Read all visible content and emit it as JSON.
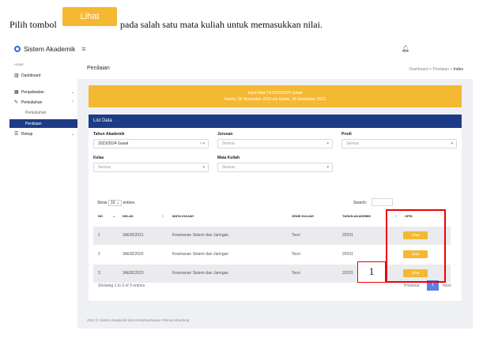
{
  "instruction": {
    "before": "Pilih tombol",
    "button_label": "Lihat",
    "after": "pada salah satu mata kuliah untuk memasukkan nilai."
  },
  "app": {
    "brand": "Sistem Akademik",
    "sidebar": {
      "heading": "HOME",
      "items": [
        {
          "label": "Dashboard",
          "icon": "bar-chart-icon"
        },
        {
          "label": "Penjadwalan",
          "icon": "calendar-icon"
        },
        {
          "label": "Perkuliahan",
          "icon": "pencil-icon"
        },
        {
          "label": "Perkuliahan",
          "icon": ""
        },
        {
          "label": "Penilaian",
          "icon": "",
          "active": true
        },
        {
          "label": "Rekap",
          "icon": "list-icon"
        }
      ]
    },
    "page_title": "Penilaian",
    "breadcrumb": [
      "Dashboard",
      "Penilaian",
      "Index"
    ],
    "notice": {
      "line1": "Input Nilai TA 2023/2024 Gasal",
      "line2": "Kamis, 09 November 2023 s/d Kamis, 30 November 2023"
    },
    "card_title": "List Data",
    "filters": {
      "tahun_akademik": {
        "label": "Tahun Akademik",
        "value": "2023/2024 Gasal"
      },
      "jurusan": {
        "label": "Jurusan",
        "placeholder": "Semua"
      },
      "prodi": {
        "label": "Prodi",
        "placeholder": "Semua"
      },
      "kelas": {
        "label": "Kelas",
        "placeholder": "Semua"
      },
      "mata_kuliah": {
        "label": "Mata Kuliah",
        "placeholder": "Semua"
      }
    },
    "show": {
      "prefix": "Show",
      "value": "10",
      "suffix": "entries"
    },
    "search_label": "Search:",
    "columns": [
      "NO",
      "KELAS",
      "MATA KULIAH",
      "JENIS KULIAH",
      "TAHUN AKADEMIK",
      "OPSI"
    ],
    "rows": [
      {
        "no": "1",
        "kelas": "3AEB22021",
        "mata_kuliah": "Keamanan Sistem dan Jaringan",
        "jenis": "Teori",
        "tahun": "20231",
        "opsi": "Lihat"
      },
      {
        "no": "2",
        "kelas": "3AEB22022",
        "mata_kuliah": "Keamanan Sistem dan Jaringan",
        "jenis": "Teori",
        "tahun": "20231",
        "opsi": "Lihat"
      },
      {
        "no": "3",
        "kelas": "3AEB22023",
        "mata_kuliah": "Keamanan Sistem dan Jaringan",
        "jenis": "Teori",
        "tahun": "20231",
        "opsi": "Lihat"
      }
    ],
    "entries_info": "Showing 1 to 3 of 3 entries",
    "pagination": {
      "previous": "Previous",
      "current": "1",
      "next": "Next"
    },
    "footer": "2022 © Sistem Akademik dan Kemahasiswaan Polman Bandung"
  },
  "annotation": {
    "step_number": "1"
  },
  "colors": {
    "accent_yellow": "#f5b833",
    "primary_blue": "#1d3b86",
    "highlight_red": "#ee0000"
  }
}
